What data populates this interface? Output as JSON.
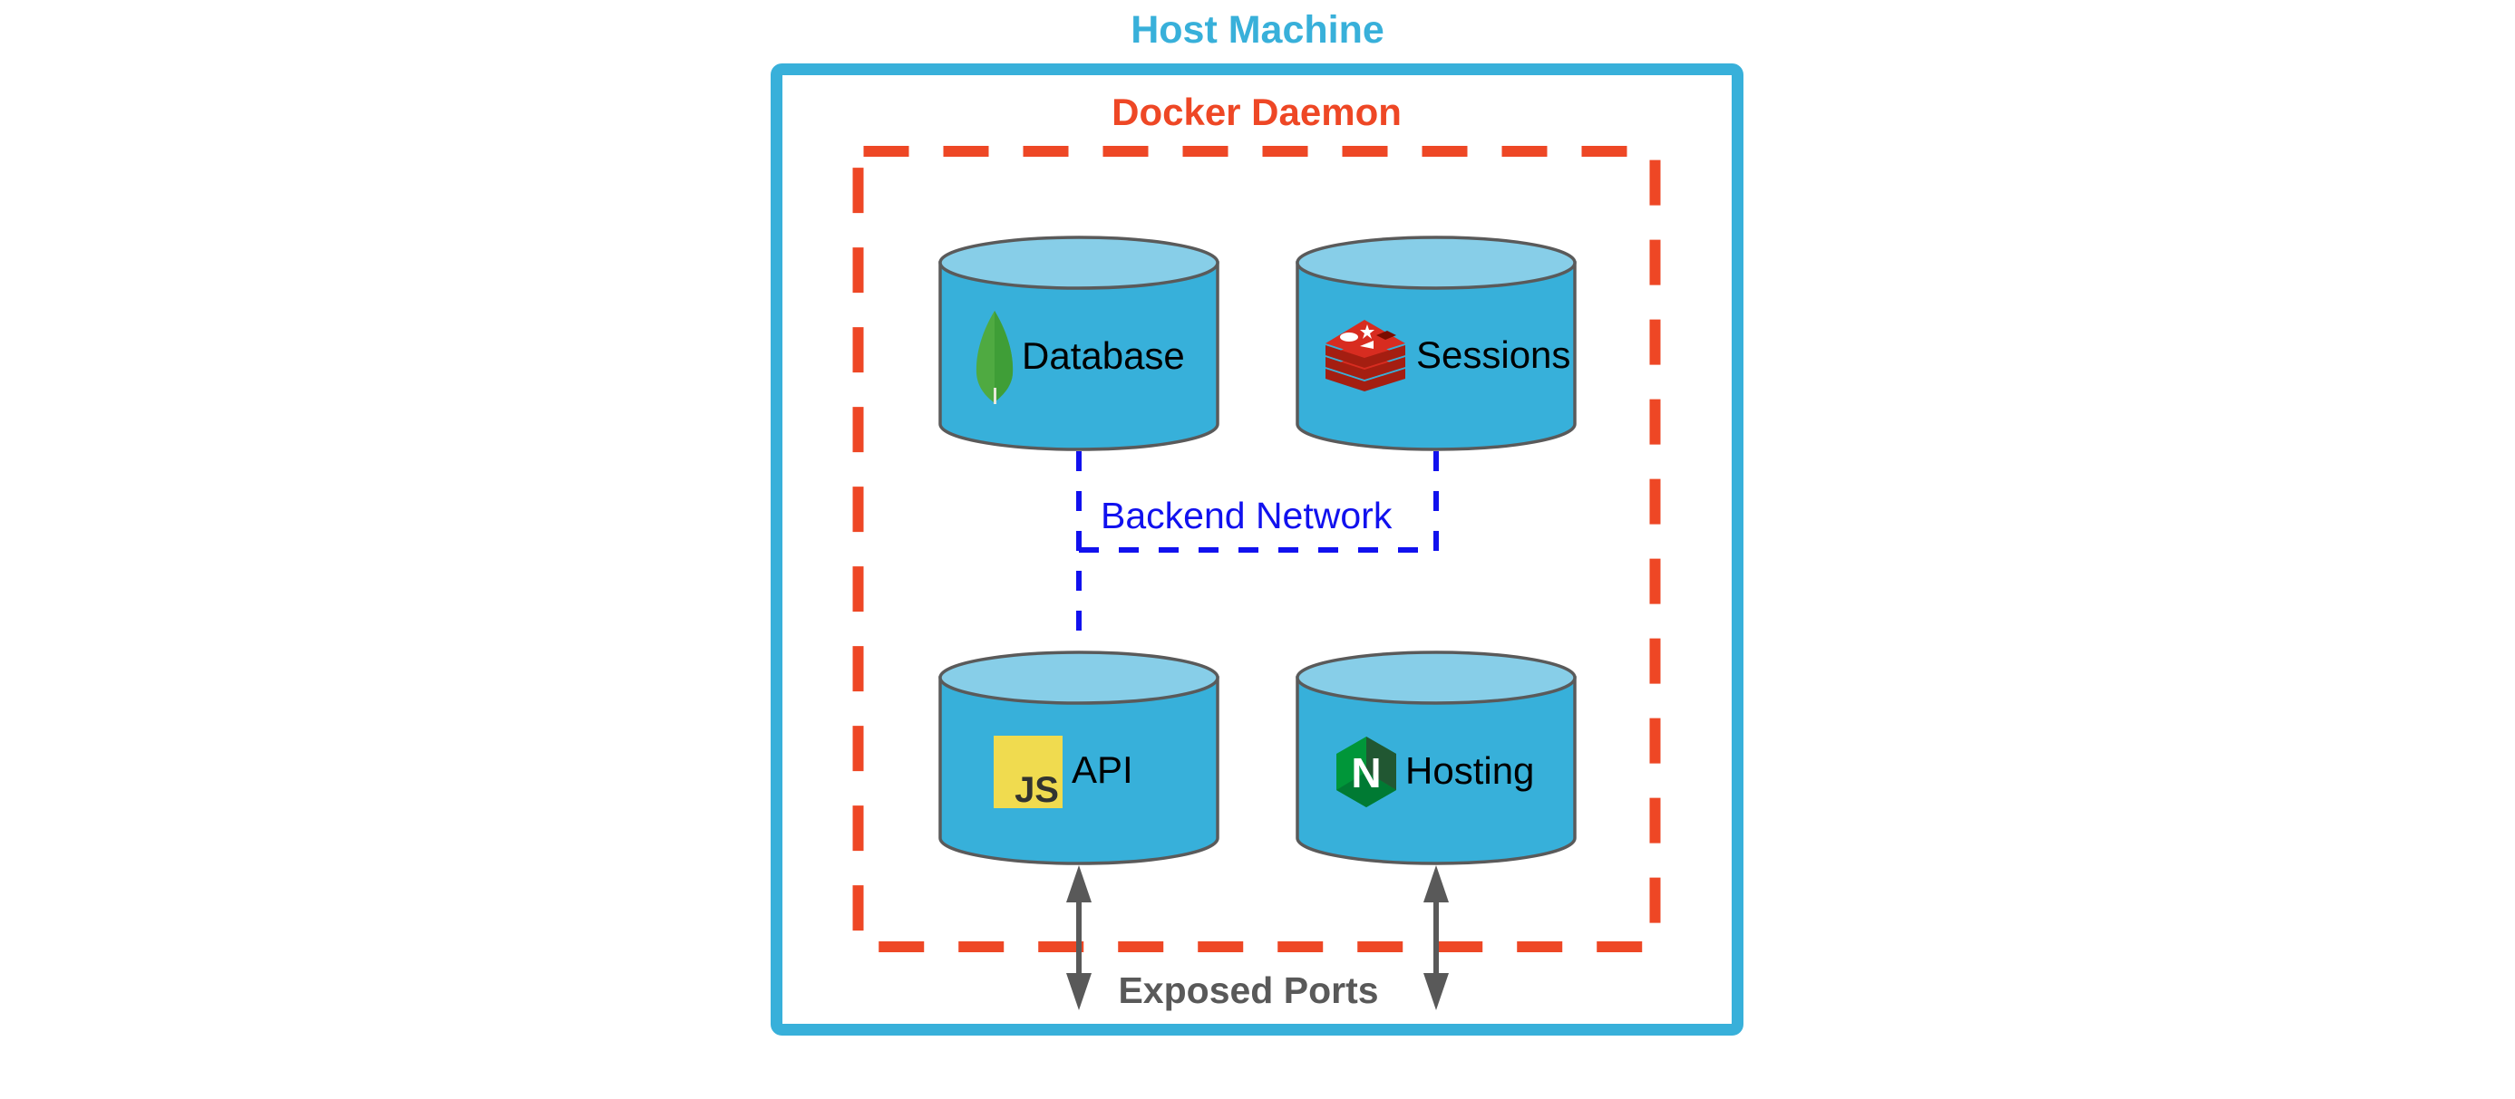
{
  "host": {
    "title": "Host Machine",
    "color": "#38B0DA"
  },
  "daemon": {
    "title": "Docker Daemon",
    "color": "#EE4725"
  },
  "network": {
    "label": "Backend Network",
    "color": "#1111EE"
  },
  "ports": {
    "label": "Exposed Ports",
    "color": "#595959"
  },
  "containers": [
    {
      "id": "database",
      "label": "Database",
      "icon": "mongodb-leaf-icon"
    },
    {
      "id": "sessions",
      "label": "Sessions",
      "icon": "redis-icon"
    },
    {
      "id": "api",
      "label": "API",
      "icon": "javascript-icon",
      "icon_text": "JS"
    },
    {
      "id": "hosting",
      "label": "Hosting",
      "icon": "nginx-icon",
      "icon_text": "N"
    }
  ],
  "colors": {
    "cylinder_body": "#37B0DA",
    "cylinder_top": "#87CEE8",
    "cylinder_stroke": "#5A5A5A"
  }
}
